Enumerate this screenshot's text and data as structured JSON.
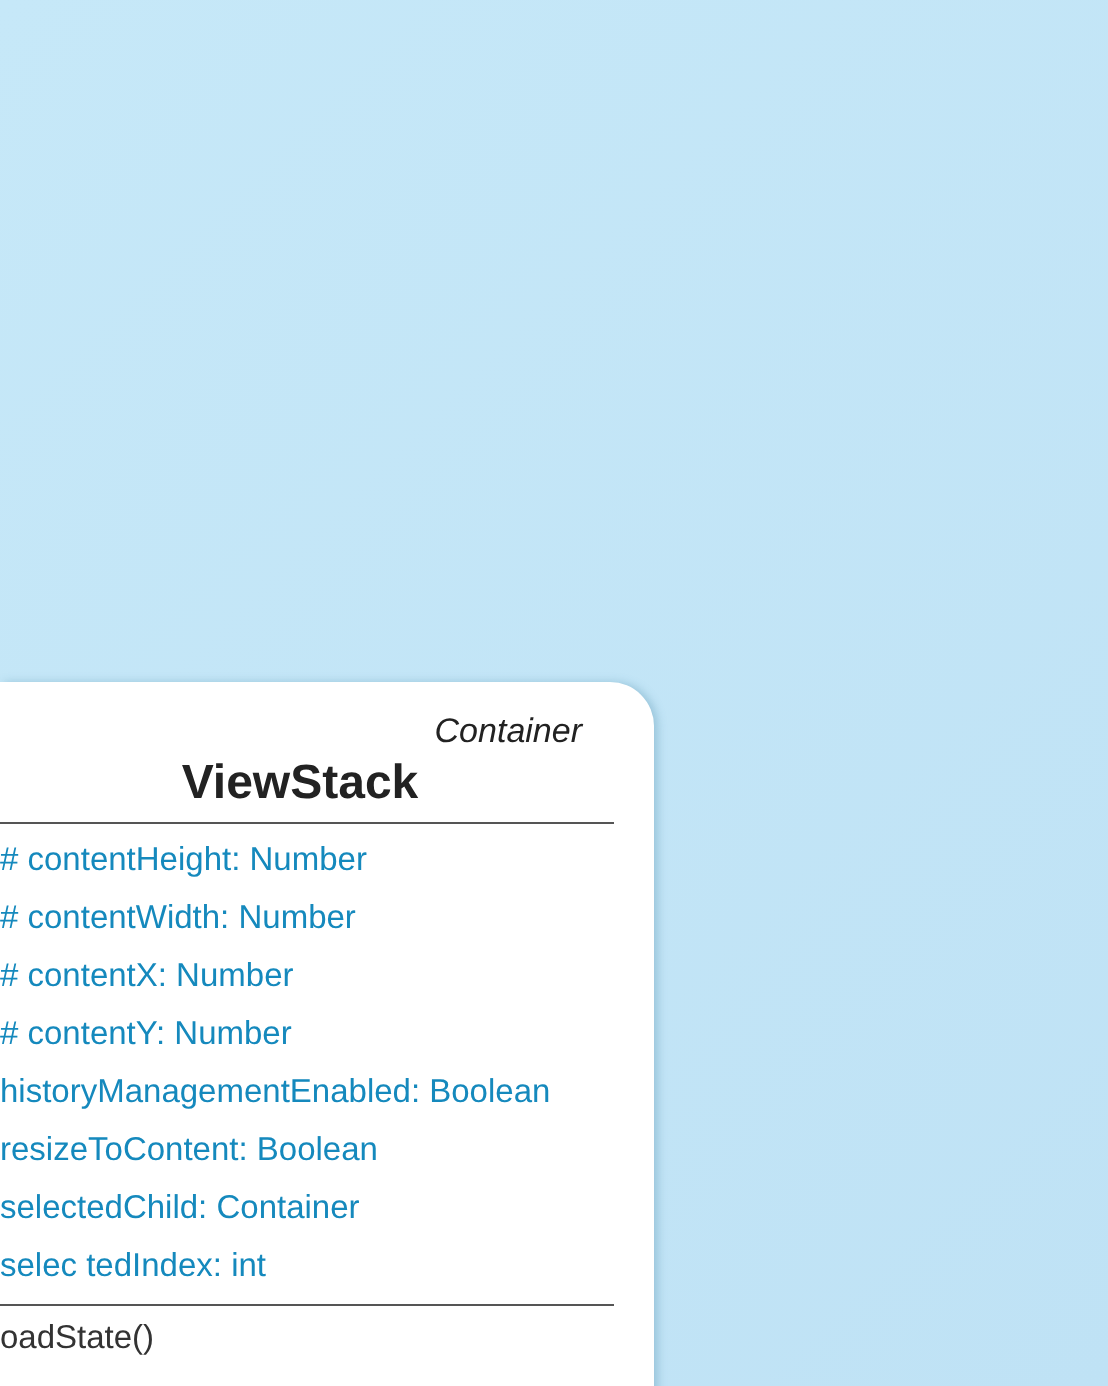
{
  "class_box": {
    "stereotype": "Container",
    "name": "ViewStack",
    "attributes": [
      "# contentHeight: Number",
      "# contentWidth: Number",
      "# contentX: Number",
      "# contentY: Number",
      "historyManagementEnabled: Boolean",
      "resizeToContent: Boolean",
      "selectedChild: Container",
      "selec tedIndex: int"
    ],
    "methods": [
      "oadState()"
    ]
  }
}
